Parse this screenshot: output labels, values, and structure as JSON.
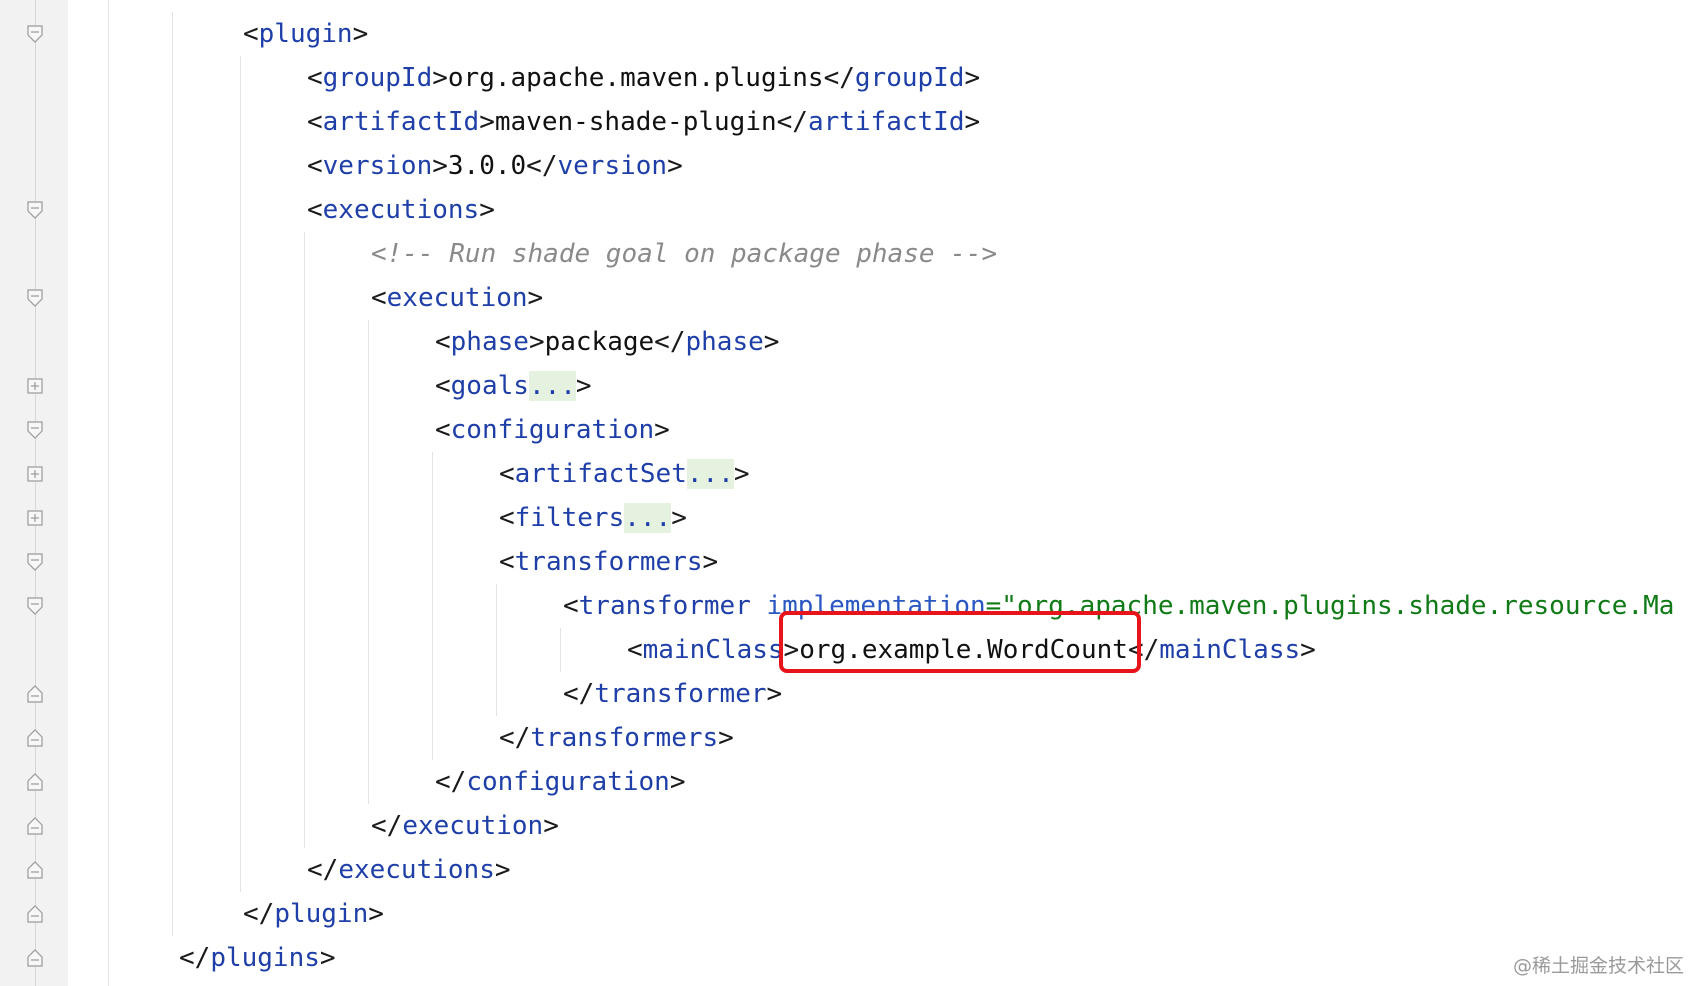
{
  "editor": {
    "lines": [
      {
        "id": "l1",
        "indent": 0,
        "parts": [
          [
            "p",
            "<"
          ],
          [
            "tag",
            "plugin"
          ],
          [
            "p",
            ">"
          ]
        ]
      },
      {
        "id": "l2",
        "indent": 1,
        "parts": [
          [
            "p",
            "<"
          ],
          [
            "tag",
            "groupId"
          ],
          [
            "p",
            ">"
          ],
          [
            "txt",
            "org.apache.maven.plugins"
          ],
          [
            "p",
            "</"
          ],
          [
            "tag",
            "groupId"
          ],
          [
            "p",
            ">"
          ]
        ]
      },
      {
        "id": "l3",
        "indent": 1,
        "parts": [
          [
            "p",
            "<"
          ],
          [
            "tag",
            "artifactId"
          ],
          [
            "p",
            ">"
          ],
          [
            "txt",
            "maven-shade-plugin"
          ],
          [
            "p",
            "</"
          ],
          [
            "tag",
            "artifactId"
          ],
          [
            "p",
            ">"
          ]
        ]
      },
      {
        "id": "l4",
        "indent": 1,
        "parts": [
          [
            "p",
            "<"
          ],
          [
            "tag",
            "version"
          ],
          [
            "p",
            ">"
          ],
          [
            "txt",
            "3.0.0"
          ],
          [
            "p",
            "</"
          ],
          [
            "tag",
            "version"
          ],
          [
            "p",
            ">"
          ]
        ]
      },
      {
        "id": "l5",
        "indent": 1,
        "parts": [
          [
            "p",
            "<"
          ],
          [
            "tag",
            "executions"
          ],
          [
            "p",
            ">"
          ]
        ]
      },
      {
        "id": "l6",
        "indent": 2,
        "parts": [
          [
            "cmt",
            "<!-- Run shade goal on package phase -->"
          ]
        ]
      },
      {
        "id": "l7",
        "indent": 2,
        "parts": [
          [
            "p",
            "<"
          ],
          [
            "tag",
            "execution"
          ],
          [
            "p",
            ">"
          ]
        ]
      },
      {
        "id": "l8",
        "indent": 3,
        "parts": [
          [
            "p",
            "<"
          ],
          [
            "tag",
            "phase"
          ],
          [
            "p",
            ">"
          ],
          [
            "txt",
            "package"
          ],
          [
            "p",
            "</"
          ],
          [
            "tag",
            "phase"
          ],
          [
            "p",
            ">"
          ]
        ]
      },
      {
        "id": "l9",
        "indent": 3,
        "parts": [
          [
            "p",
            "<"
          ],
          [
            "tag",
            "goals"
          ],
          [
            "foldtxt",
            "..."
          ],
          [
            "p",
            ">"
          ]
        ]
      },
      {
        "id": "l10",
        "indent": 3,
        "parts": [
          [
            "p",
            "<"
          ],
          [
            "tag",
            "configuration"
          ],
          [
            "p",
            ">"
          ]
        ]
      },
      {
        "id": "l11",
        "indent": 4,
        "parts": [
          [
            "p",
            "<"
          ],
          [
            "tag",
            "artifactSet"
          ],
          [
            "foldtxt",
            "..."
          ],
          [
            "p",
            ">"
          ]
        ]
      },
      {
        "id": "l12",
        "indent": 4,
        "parts": [
          [
            "p",
            "<"
          ],
          [
            "tag",
            "filters"
          ],
          [
            "foldtxt",
            "..."
          ],
          [
            "p",
            ">"
          ]
        ]
      },
      {
        "id": "l13",
        "indent": 4,
        "parts": [
          [
            "p",
            "<"
          ],
          [
            "tag",
            "transformers"
          ],
          [
            "p",
            ">"
          ]
        ]
      },
      {
        "id": "l14",
        "indent": 5,
        "parts": [
          [
            "p",
            "<"
          ],
          [
            "tag",
            "transformer "
          ],
          [
            "attr",
            "implementation"
          ],
          [
            "str",
            "=\"org.apache.maven.plugins.shade.resource.Ma"
          ]
        ]
      },
      {
        "id": "l15",
        "indent": 6,
        "parts": [
          [
            "p",
            "<"
          ],
          [
            "tag",
            "mainClass"
          ],
          [
            "p",
            ">"
          ],
          [
            "txt",
            "org.example.WordCount"
          ],
          [
            "p",
            "</"
          ],
          [
            "tag",
            "mainClass"
          ],
          [
            "p",
            ">"
          ]
        ]
      },
      {
        "id": "l16",
        "indent": 5,
        "parts": [
          [
            "p",
            "</"
          ],
          [
            "tag",
            "transformer"
          ],
          [
            "p",
            ">"
          ]
        ]
      },
      {
        "id": "l17",
        "indent": 4,
        "parts": [
          [
            "p",
            "</"
          ],
          [
            "tag",
            "transformers"
          ],
          [
            "p",
            ">"
          ]
        ]
      },
      {
        "id": "l18",
        "indent": 3,
        "parts": [
          [
            "p",
            "</"
          ],
          [
            "tag",
            "configuration"
          ],
          [
            "p",
            ">"
          ]
        ]
      },
      {
        "id": "l19",
        "indent": 2,
        "parts": [
          [
            "p",
            "</"
          ],
          [
            "tag",
            "execution"
          ],
          [
            "p",
            ">"
          ]
        ]
      },
      {
        "id": "l20",
        "indent": 1,
        "parts": [
          [
            "p",
            "</"
          ],
          [
            "tag",
            "executions"
          ],
          [
            "p",
            ">"
          ]
        ]
      },
      {
        "id": "l21",
        "indent": 0,
        "parts": [
          [
            "p",
            "</"
          ],
          [
            "tag",
            "plugin"
          ],
          [
            "p",
            ">"
          ]
        ]
      },
      {
        "id": "l22",
        "indent": -1,
        "parts": [
          [
            "p",
            "</"
          ],
          [
            "tag",
            "plugins"
          ],
          [
            "p",
            ">"
          ]
        ]
      }
    ],
    "fold_markers": [
      "open",
      "none",
      "none",
      "none",
      "open",
      "none",
      "open",
      "none",
      "collapsed",
      "open",
      "collapsed",
      "collapsed",
      "open",
      "open",
      "none",
      "close",
      "close",
      "close",
      "close",
      "close",
      "close",
      "close"
    ]
  },
  "highlight": {
    "text": "org.example.WordCount",
    "color": "#e8141c"
  },
  "watermark": "@稀土掘金技术社区",
  "colors": {
    "tag": "#1f3fa8",
    "attr": "#2b57c2",
    "string": "#0f7a16",
    "comment": "#8a8a8a",
    "text": "#111111",
    "fold_bg": "#e6f2e0"
  }
}
